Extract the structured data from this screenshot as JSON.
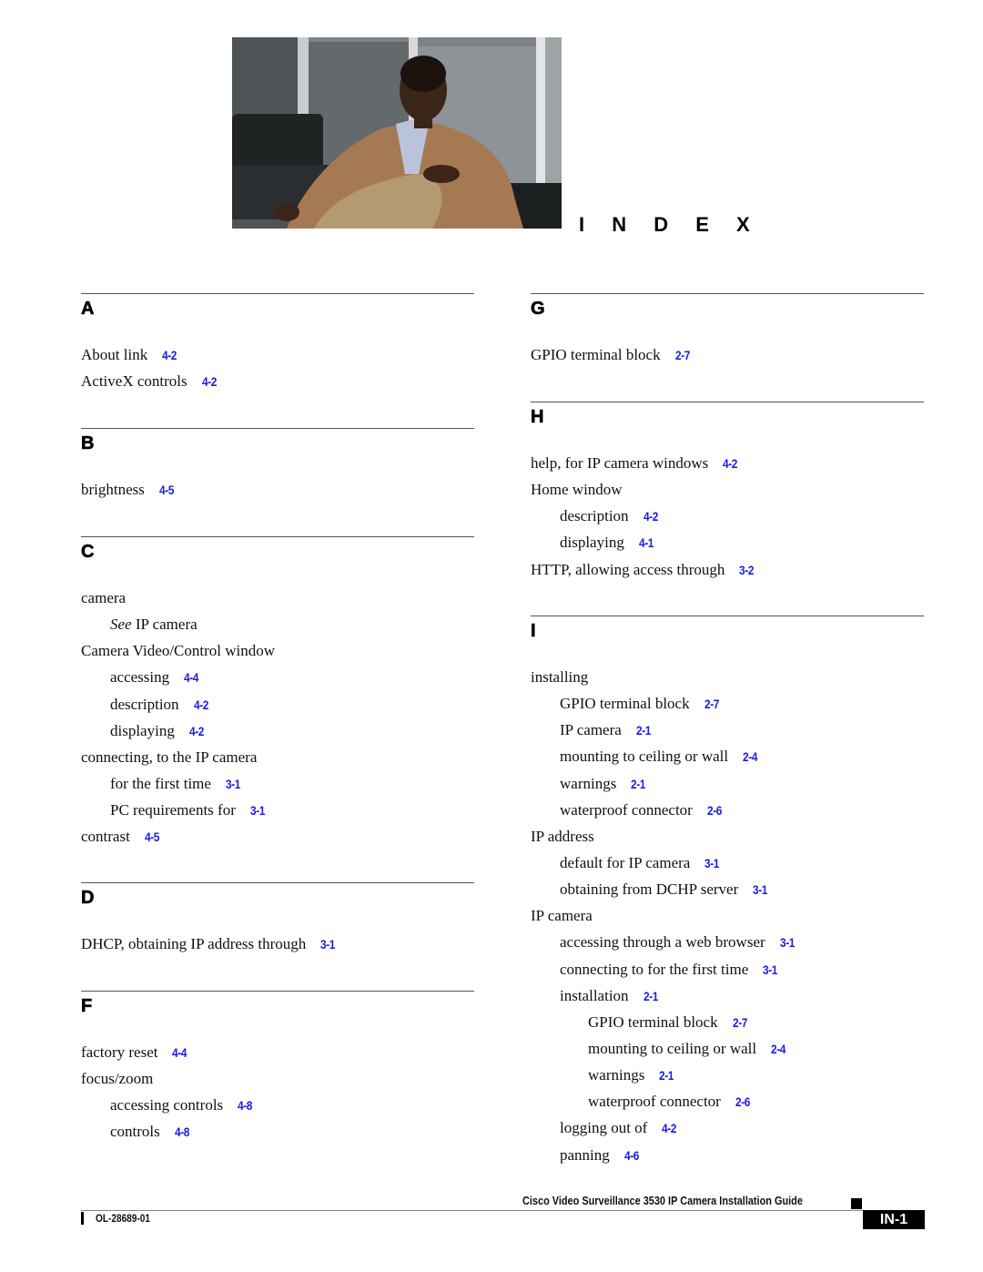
{
  "header": {
    "title": "I N D E X",
    "photo_alt": "man-seated-in-office-photo"
  },
  "columns": {
    "left": [
      {
        "letter": "A",
        "entries": [
          {
            "level": 0,
            "text": "About link",
            "ref": "4-2"
          },
          {
            "level": 0,
            "text": "ActiveX controls",
            "ref": "4-2"
          }
        ]
      },
      {
        "letter": "B",
        "entries": [
          {
            "level": 0,
            "text": "brightness",
            "ref": "4-5"
          }
        ]
      },
      {
        "letter": "C",
        "entries": [
          {
            "level": 0,
            "text": "camera",
            "ref": null
          },
          {
            "level": 1,
            "see": "See",
            "text": " IP camera",
            "ref": null
          },
          {
            "level": 0,
            "text": "Camera Video/Control window",
            "ref": null
          },
          {
            "level": 1,
            "text": "accessing",
            "ref": "4-4"
          },
          {
            "level": 1,
            "text": "description",
            "ref": "4-2"
          },
          {
            "level": 1,
            "text": "displaying",
            "ref": "4-2"
          },
          {
            "level": 0,
            "text": "connecting, to the IP camera",
            "ref": null
          },
          {
            "level": 1,
            "text": "for the first time",
            "ref": "3-1"
          },
          {
            "level": 1,
            "text": "PC requirements for",
            "ref": "3-1"
          },
          {
            "level": 0,
            "text": "contrast",
            "ref": "4-5"
          }
        ]
      },
      {
        "letter": "D",
        "entries": [
          {
            "level": 0,
            "text": "DHCP, obtaining IP address through",
            "ref": "3-1"
          }
        ]
      },
      {
        "letter": "F",
        "entries": [
          {
            "level": 0,
            "text": "factory reset",
            "ref": "4-4"
          },
          {
            "level": 0,
            "text": "focus/zoom",
            "ref": null
          },
          {
            "level": 1,
            "text": "accessing controls",
            "ref": "4-8"
          },
          {
            "level": 1,
            "text": "controls",
            "ref": "4-8"
          }
        ]
      }
    ],
    "right": [
      {
        "letter": "G",
        "entries": [
          {
            "level": 0,
            "text": "GPIO terminal block",
            "ref": "2-7"
          }
        ]
      },
      {
        "letter": "H",
        "entries": [
          {
            "level": 0,
            "text": "help, for IP camera windows",
            "ref": "4-2"
          },
          {
            "level": 0,
            "text": "Home window",
            "ref": null
          },
          {
            "level": 1,
            "text": "description",
            "ref": "4-2"
          },
          {
            "level": 1,
            "text": "displaying",
            "ref": "4-1"
          },
          {
            "level": 0,
            "text": "HTTP, allowing access through",
            "ref": "3-2"
          }
        ]
      },
      {
        "letter": "I",
        "entries": [
          {
            "level": 0,
            "text": "installing",
            "ref": null
          },
          {
            "level": 1,
            "text": "GPIO terminal block",
            "ref": "2-7"
          },
          {
            "level": 1,
            "text": "IP camera",
            "ref": "2-1"
          },
          {
            "level": 1,
            "text": "mounting to ceiling or wall",
            "ref": "2-4"
          },
          {
            "level": 1,
            "text": "warnings",
            "ref": "2-1"
          },
          {
            "level": 1,
            "text": "waterproof connector",
            "ref": "2-6"
          },
          {
            "level": 0,
            "text": "IP address",
            "ref": null
          },
          {
            "level": 1,
            "text": "default for IP camera",
            "ref": "3-1"
          },
          {
            "level": 1,
            "text": "obtaining from DCHP server",
            "ref": "3-1"
          },
          {
            "level": 0,
            "text": "IP camera",
            "ref": null
          },
          {
            "level": 1,
            "text": "accessing through a web browser",
            "ref": "3-1"
          },
          {
            "level": 1,
            "text": "connecting to for the first time",
            "ref": "3-1"
          },
          {
            "level": 1,
            "text": "installation",
            "ref": "2-1"
          },
          {
            "level": 2,
            "text": "GPIO terminal block",
            "ref": "2-7"
          },
          {
            "level": 2,
            "text": "mounting to ceiling or wall",
            "ref": "2-4"
          },
          {
            "level": 2,
            "text": "warnings",
            "ref": "2-1"
          },
          {
            "level": 2,
            "text": "waterproof connector",
            "ref": "2-6"
          },
          {
            "level": 1,
            "text": "logging out of",
            "ref": "4-2"
          },
          {
            "level": 1,
            "text": "panning",
            "ref": "4-6"
          }
        ]
      }
    ]
  },
  "footer": {
    "guide_title": "Cisco Video Surveillance 3530 IP Camera Installation Guide",
    "doc_number": "OL-28689-01",
    "page_number": "IN-1"
  },
  "colors": {
    "link": "#1a1ae6",
    "text": "#111111",
    "rule": "#555555"
  }
}
